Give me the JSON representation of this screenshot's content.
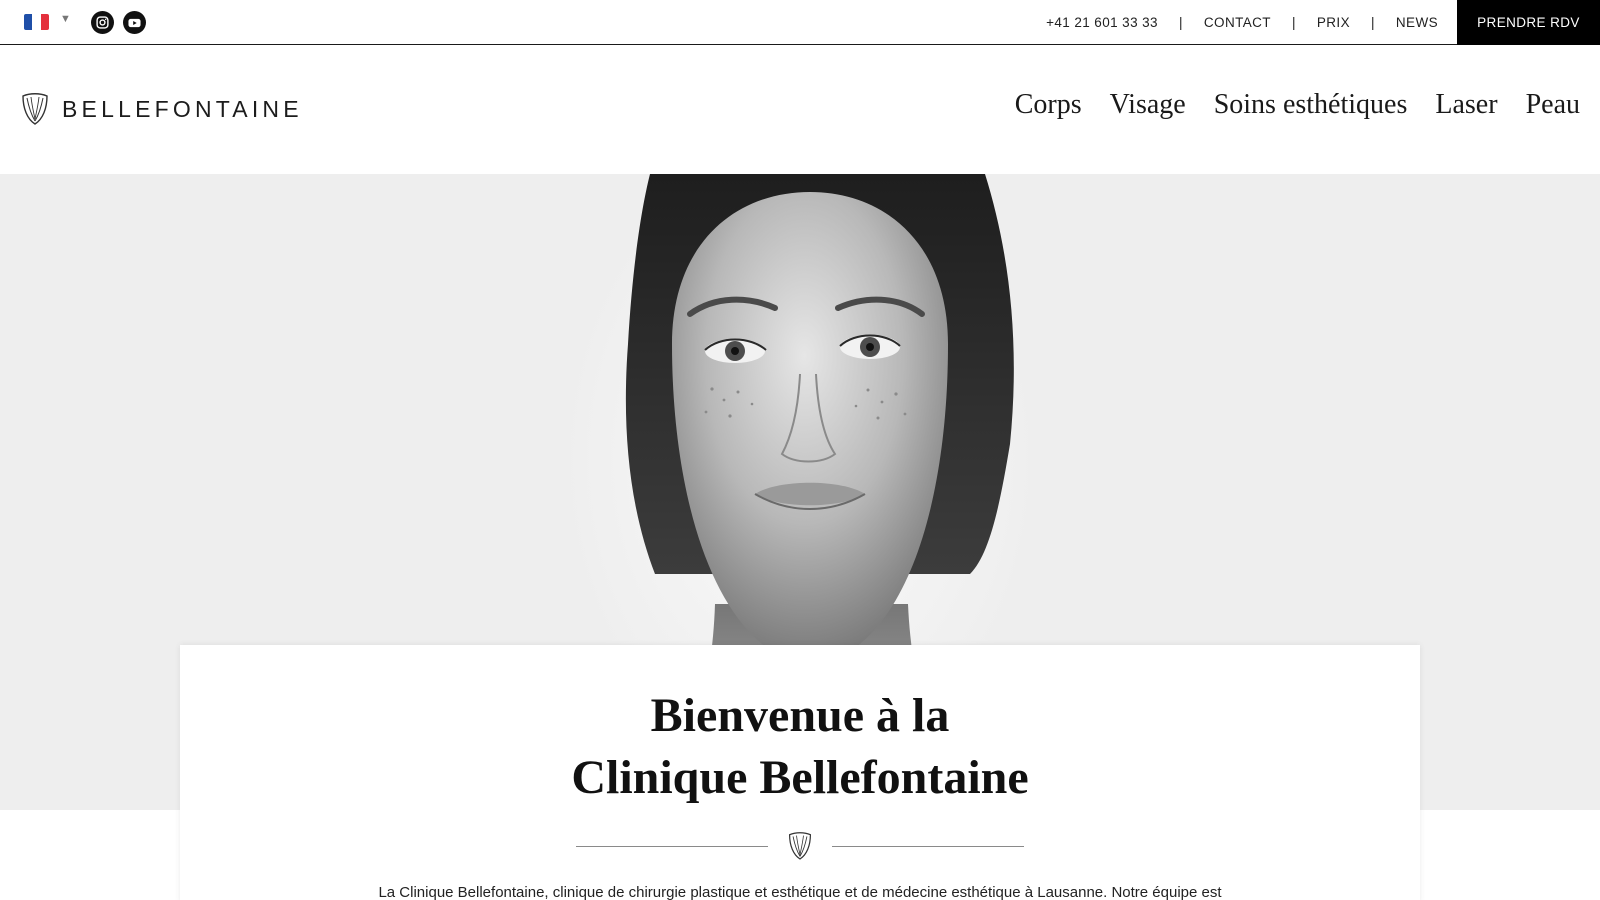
{
  "topbar": {
    "language": {
      "current": "FR",
      "flag_colors": [
        "#1f4fa8",
        "#ffffff",
        "#e4303c"
      ]
    },
    "social": [
      {
        "name": "instagram-icon"
      },
      {
        "name": "youtube-icon"
      }
    ],
    "phone": "+41 21 601 33 33",
    "links": [
      "CONTACT",
      "PRIX",
      "NEWS"
    ],
    "separator": "|",
    "cta_label": "PRENDRE RDV"
  },
  "header": {
    "logo_text": "BELLEFONTAINE",
    "nav": [
      "Corps",
      "Visage",
      "Soins esthétiques",
      "Laser",
      "Peau"
    ]
  },
  "welcome": {
    "title_line1": "Bienvenue à la",
    "title_line2": "Clinique Bellefontaine",
    "intro": "La Clinique Bellefontaine, clinique de chirurgie plastique et esthétique et de médecine esthétique à Lausanne. Notre équipe est"
  },
  "colors": {
    "accent": "#000000",
    "hero_background": "#eeeeee",
    "text": "#111111"
  }
}
